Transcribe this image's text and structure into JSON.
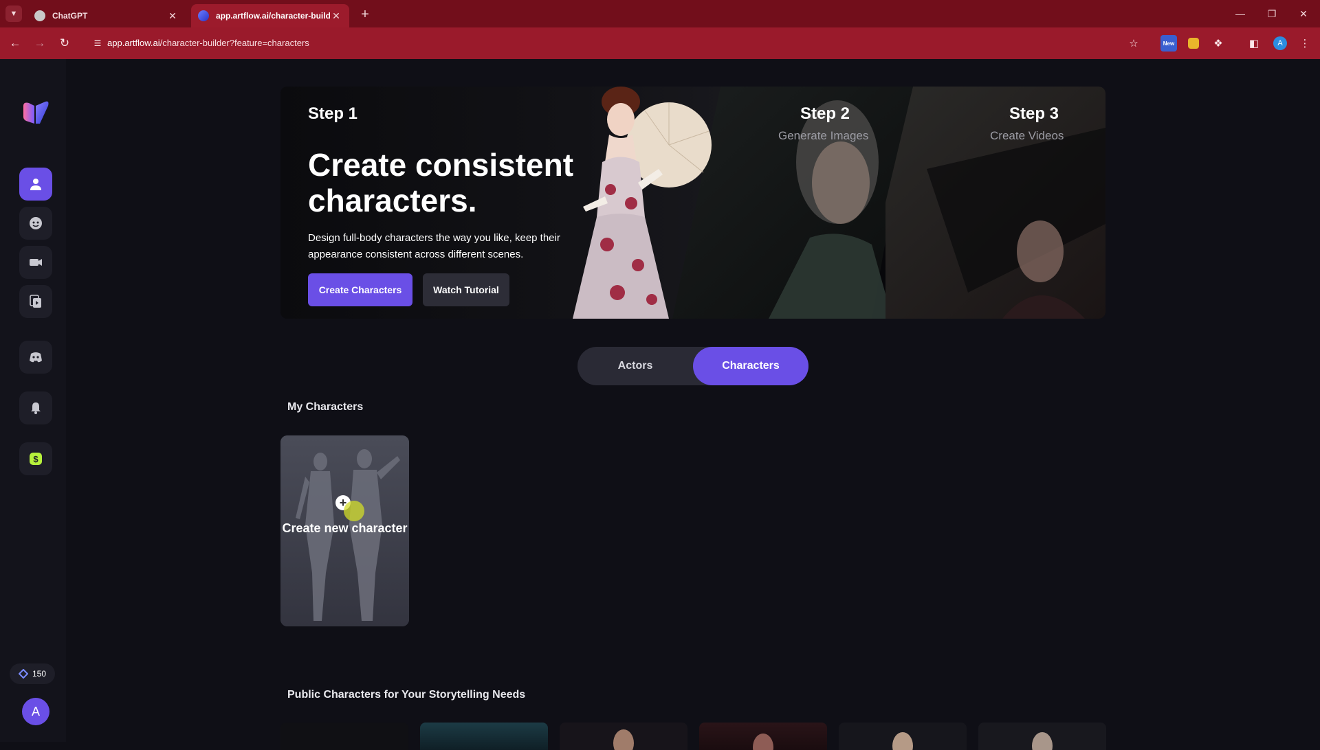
{
  "browser": {
    "tabs": [
      {
        "title": "ChatGPT",
        "active": false
      },
      {
        "title": "app.artflow.ai/character-builder",
        "active": true
      }
    ],
    "url_host": "app.artflow.ai",
    "url_path": "/character-builder?feature=characters",
    "extension_new_badge": "New",
    "profile_initial": "A"
  },
  "sidebar": {
    "items": [
      {
        "name": "characters",
        "icon": "person-icon",
        "active": true
      },
      {
        "name": "image-generator",
        "icon": "face-icon",
        "active": false
      },
      {
        "name": "video",
        "icon": "video-camera-icon",
        "active": false
      },
      {
        "name": "clips",
        "icon": "media-library-icon",
        "active": false
      },
      {
        "name": "discord",
        "icon": "discord-icon",
        "active": false
      },
      {
        "name": "notifications",
        "icon": "bell-icon",
        "active": false
      },
      {
        "name": "pricing",
        "icon": "dollar-icon",
        "active": false
      }
    ],
    "credits": "150",
    "avatar_initial": "A"
  },
  "hero": {
    "step1": {
      "label": "Step 1"
    },
    "title": "Create consistent characters.",
    "description": "Design full-body characters the way you like, keep their appearance consistent across different scenes.",
    "primary_button": "Create Characters",
    "secondary_button": "Watch Tutorial",
    "step2": {
      "label": "Step 2",
      "sub": "Generate Images"
    },
    "step3": {
      "label": "Step 3",
      "sub": "Create Videos"
    }
  },
  "toggle": {
    "options": [
      "Actors",
      "Characters"
    ],
    "selected": "Characters"
  },
  "my_characters": {
    "title": "My Characters",
    "create_card_label": "Create new character"
  },
  "public_characters": {
    "title": "Public Characters for Your Storytelling Needs"
  },
  "colors": {
    "accent": "#6a4fe6",
    "browser_frame": "#9a1a2b",
    "page_bg": "#0f0f16"
  }
}
